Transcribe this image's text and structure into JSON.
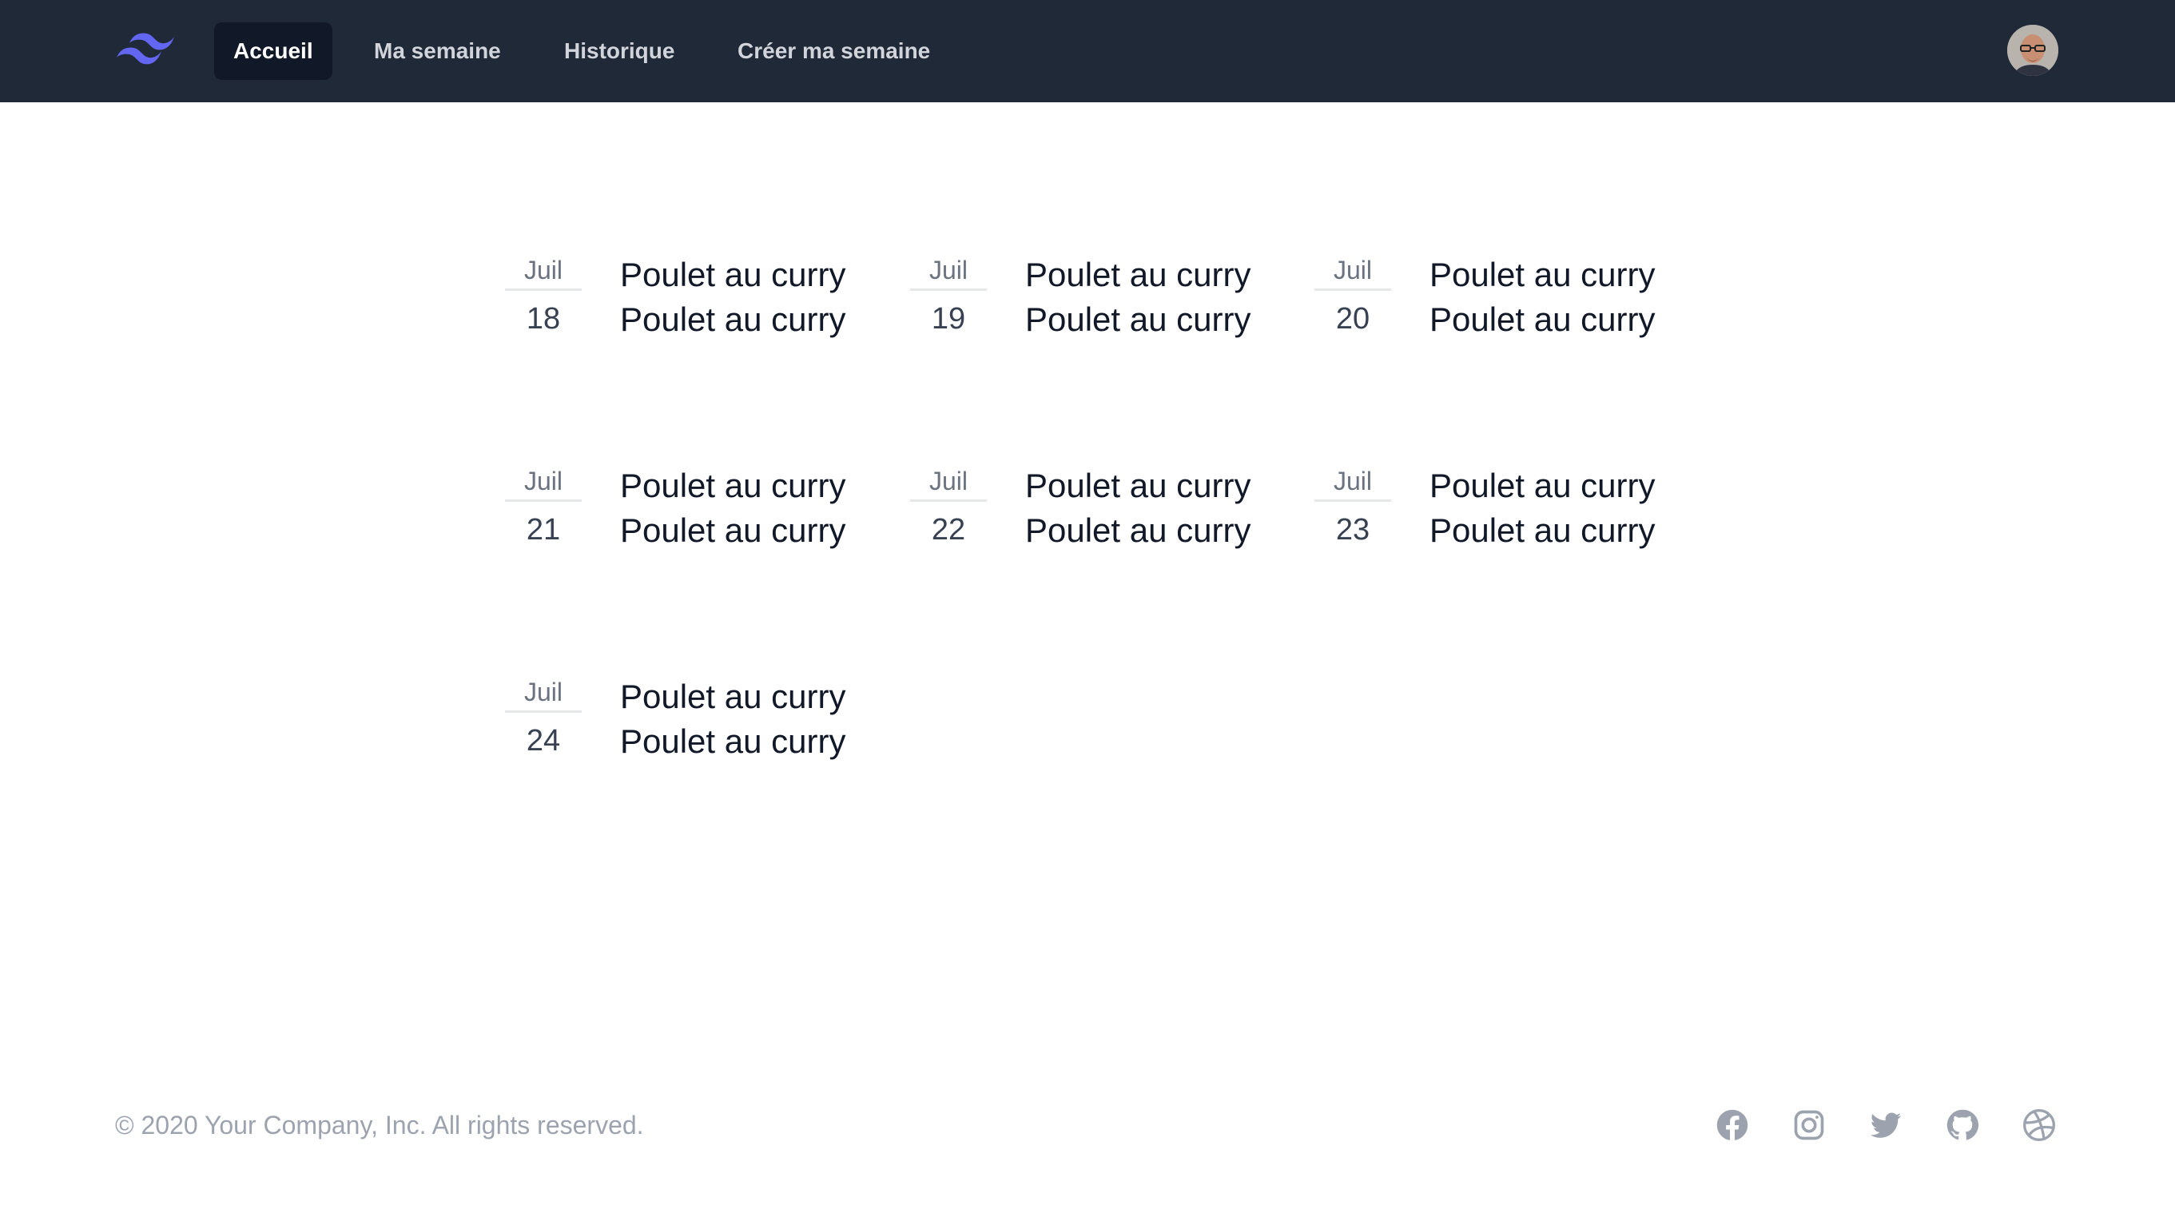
{
  "nav": {
    "logo_icon": "tailwind-wave-logo-icon",
    "accent_color": "#6366f1",
    "items": [
      {
        "label": "Accueil",
        "active": true
      },
      {
        "label": "Ma semaine",
        "active": false
      },
      {
        "label": "Historique",
        "active": false
      },
      {
        "label": "Créer ma semaine",
        "active": false
      }
    ],
    "avatar_icon": "user-avatar"
  },
  "week": {
    "days": [
      {
        "month": "Juil",
        "day": "18",
        "meals": [
          "Poulet au curry",
          "Poulet au curry"
        ]
      },
      {
        "month": "Juil",
        "day": "19",
        "meals": [
          "Poulet au curry",
          "Poulet au curry"
        ]
      },
      {
        "month": "Juil",
        "day": "20",
        "meals": [
          "Poulet au curry",
          "Poulet au curry"
        ]
      },
      {
        "month": "Juil",
        "day": "21",
        "meals": [
          "Poulet au curry",
          "Poulet au curry"
        ]
      },
      {
        "month": "Juil",
        "day": "22",
        "meals": [
          "Poulet au curry",
          "Poulet au curry"
        ]
      },
      {
        "month": "Juil",
        "day": "23",
        "meals": [
          "Poulet au curry",
          "Poulet au curry"
        ]
      },
      {
        "month": "Juil",
        "day": "24",
        "meals": [
          "Poulet au curry",
          "Poulet au curry"
        ]
      }
    ]
  },
  "footer": {
    "copyright": "© 2020 Your Company, Inc. All rights reserved.",
    "social_icons": [
      "facebook-icon",
      "instagram-icon",
      "twitter-icon",
      "github-icon",
      "dribbble-icon"
    ]
  }
}
